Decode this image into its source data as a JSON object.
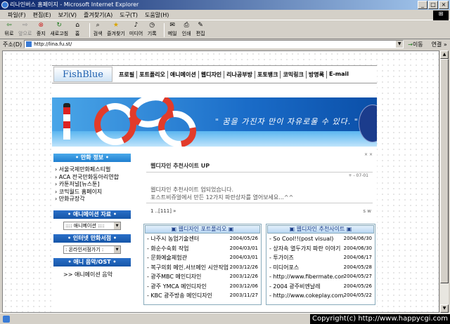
{
  "window": {
    "title": "리나인버스 홈페이지 - Microsoft Internet Explorer",
    "buttons": [
      "_",
      "□",
      "×"
    ]
  },
  "menu": [
    "파일(F)",
    "편집(E)",
    "보기(V)",
    "즐겨찾기(A)",
    "도구(T)",
    "도움말(H)"
  ],
  "toolbar": {
    "items": [
      {
        "label": "뒤로",
        "icon": "back-arrow-icon",
        "enabled": true
      },
      {
        "label": "앞으로",
        "icon": "forward-arrow-icon",
        "enabled": false
      },
      {
        "label": "중지",
        "icon": "stop-icon",
        "enabled": true
      },
      {
        "label": "새로고침",
        "icon": "refresh-icon",
        "enabled": true
      },
      {
        "label": "홈",
        "icon": "home-icon",
        "enabled": true
      },
      {
        "label": "검색",
        "icon": "search-icon",
        "enabled": true
      },
      {
        "label": "즐겨찾기",
        "icon": "favorites-icon",
        "enabled": true
      },
      {
        "label": "미디어",
        "icon": "media-icon",
        "enabled": true
      },
      {
        "label": "기록",
        "icon": "history-icon",
        "enabled": true
      },
      {
        "label": "메일",
        "icon": "mail-icon",
        "enabled": true
      },
      {
        "label": "인쇄",
        "icon": "print-icon",
        "enabled": true
      },
      {
        "label": "편집",
        "icon": "edit-icon",
        "enabled": true
      }
    ]
  },
  "address": {
    "label": "주소(D)",
    "url": "http://lina.fu.st/",
    "go": "이동",
    "links": "연결 »"
  },
  "site": {
    "logo": "FishBlue",
    "nav": [
      "프로필",
      "포트폴리오",
      "애니메이션",
      "웹디자인",
      "리나공부방",
      "포토뱅크",
      "코믹링크",
      "방명록",
      "E-mail"
    ],
    "slogan": "\" 꿈을 가진자 만이 자유로울 수 있다. \"",
    "left": {
      "section1_title": "• 만화 정보 •",
      "links": [
        "서울국제만화페스티벌",
        "ACA 전국만화동아리연합",
        "카툰저널[뉴스툰]",
        "코믹월드 홈페이지",
        "만화규장각"
      ],
      "anim_title": "• 애니메이션 자료 •",
      "anim_select": ":::: 애니메이션 ::::",
      "shop_title": "• 인터넷 만화서점 •",
      "shop_select": ": 온라인서점가기 :",
      "ost_title": "• 애니 음악/OST •",
      "ost_link": ">> 애니메이션 음악"
    },
    "post": {
      "close": "× ×",
      "title": "웹디자인 추천사이트 UP",
      "date": "+ - 07-01",
      "body1": "웹디자인 추천사이트 업되었습니다.",
      "body2": "포스트비쥬얼에서 만든 12가지 파란상자를 열어보세요...^^",
      "pager": "1 ..[111] »",
      "tools": "s w"
    },
    "portfolio": {
      "title": "▣ 웹디자인 포트폴리오 ▣",
      "rows": [
        {
          "t": "- 나주시 농업기술센터",
          "d": "2004/05/26"
        },
        {
          "t": "- 화순수숙회 작업",
          "d": "2004/03/01"
        },
        {
          "t": "- 문화예술체험관",
          "d": "2004/03/01"
        },
        {
          "t": "- 복구의회 메인.서브메인 시안작업",
          "d": "2003/12/26"
        },
        {
          "t": "- 광주MBC 메인디자인",
          "d": "2003/12/26"
        },
        {
          "t": "- 광주 YMCA 메인디자인",
          "d": "2003/12/06"
        },
        {
          "t": "- KBC 광주방송 메인디자인",
          "d": "2003/11/27"
        }
      ]
    },
    "recommend": {
      "title": "▣ 웹디자인 추천사이트 ▣",
      "rows": [
        {
          "t": "- So Cool!!(post visual)",
          "d": "2004/06/30"
        },
        {
          "t": "- 상자속 열두가지 파란 이야기",
          "d": "2004/06/30"
        },
        {
          "t": "- 투가이즈",
          "d": "2004/06/17"
        },
        {
          "t": "- 미디어포스",
          "d": "2004/05/28"
        },
        {
          "t": "- http://www.fibermate.com/...",
          "d": "2004/05/27"
        },
        {
          "t": "- 2004 광주비엔날레",
          "d": "2004/05/26"
        },
        {
          "t": "- http://www.cokeplay.com/",
          "d": "2004/05/22"
        }
      ]
    }
  },
  "copyright": "Copyright(c) http://www.happycgi.com"
}
